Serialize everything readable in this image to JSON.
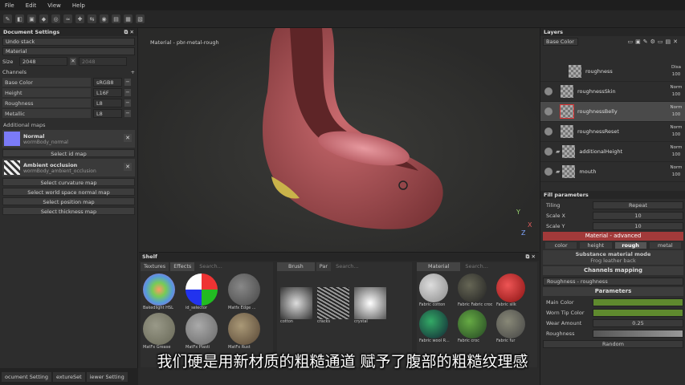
{
  "menu": {
    "file": "File",
    "edit": "Edit",
    "view": "View",
    "help": "Help"
  },
  "doc": {
    "title": "Document Settings",
    "undo": "Undo stack",
    "material": "Material",
    "size_label": "Size",
    "size_value": "2048",
    "size_value2": "2048",
    "channels": "Channels",
    "ch": [
      {
        "name": "Base Color",
        "fmt": "sRGB8"
      },
      {
        "name": "Height",
        "fmt": "L16F"
      },
      {
        "name": "Roughness",
        "fmt": "L8"
      },
      {
        "name": "Metallic",
        "fmt": "L8"
      }
    ],
    "additional": "Additional maps",
    "normal_title": "Normal",
    "normal_sub": "wormBody_normal",
    "select_id": "Select id map",
    "ao_title": "Ambient occlusion",
    "ao_sub": "wormBody_ambient_occlusion",
    "btns": [
      "Select curvature map",
      "Select world space normal map",
      "Select position map",
      "Select thickness map"
    ]
  },
  "viewport": {
    "label": "Material - pbr-metal-rough"
  },
  "shelf": {
    "title": "Shelf",
    "tabs": [
      "Textures",
      "Effects"
    ],
    "brush": "Brush",
    "par": "Par",
    "material_tab": "Material",
    "search": "Search...",
    "tex": [
      "Bakedlight HSL",
      "id_selector",
      "Matfx Edge ...",
      "MatFx Grease",
      "MatFx Plasti",
      "MatFx Rust"
    ],
    "brushes": [
      "cotton",
      "cracks",
      "crystal"
    ],
    "mats": [
      "Fabric cotton",
      "Fabric Fabric croc",
      "Fabric silk",
      "Fabric wool R...",
      "Fabric croc",
      "Fabric fur"
    ]
  },
  "layers": {
    "title": "Layers",
    "blend": "Base Color",
    "items": [
      {
        "name": "roughness",
        "mode": "Disa",
        "op": "100"
      },
      {
        "name": "roughnessSkin",
        "mode": "Norm",
        "op": "100"
      },
      {
        "name": "roughnessBelly",
        "mode": "Norm",
        "op": "100"
      },
      {
        "name": "roughnessReset",
        "mode": "Norm",
        "op": "100"
      },
      {
        "name": "additionalHeight",
        "mode": "Norm",
        "op": "100"
      },
      {
        "name": "mouth",
        "mode": "Norm",
        "op": "100"
      }
    ]
  },
  "fill": {
    "title": "Fill parameters",
    "tiling": "Tiling",
    "tiling_val": "Repeat",
    "scalex": "Scale X",
    "scalex_val": "10",
    "scaley": "Scale Y",
    "scaley_val": "10",
    "mat_adv": "Material - advanced",
    "chips": [
      "color",
      "height",
      "rough",
      "metal"
    ],
    "sub_title": "Substance material mode",
    "sub_val": "Frog leather back",
    "chmap": "Channels mapping",
    "chmap_val": "Roughness - roughness",
    "params": "Parameters",
    "main_color": "Main Color",
    "worn_color": "Worn Tip Color",
    "wear": "Wear Amount",
    "wear_val": "0.25",
    "rough": "Roughness",
    "random": "Random"
  },
  "bottom": {
    "tabs": [
      "ocument Setting",
      "extureSet",
      "iewer Setting"
    ]
  },
  "subtitle": "我们硬是用新材质的粗糙通道 赋予了腹部的粗糙纹理感",
  "colors": {
    "accent": "#a23a3a",
    "green": "#5f8a2e",
    "normal": "#7b7bf7"
  }
}
